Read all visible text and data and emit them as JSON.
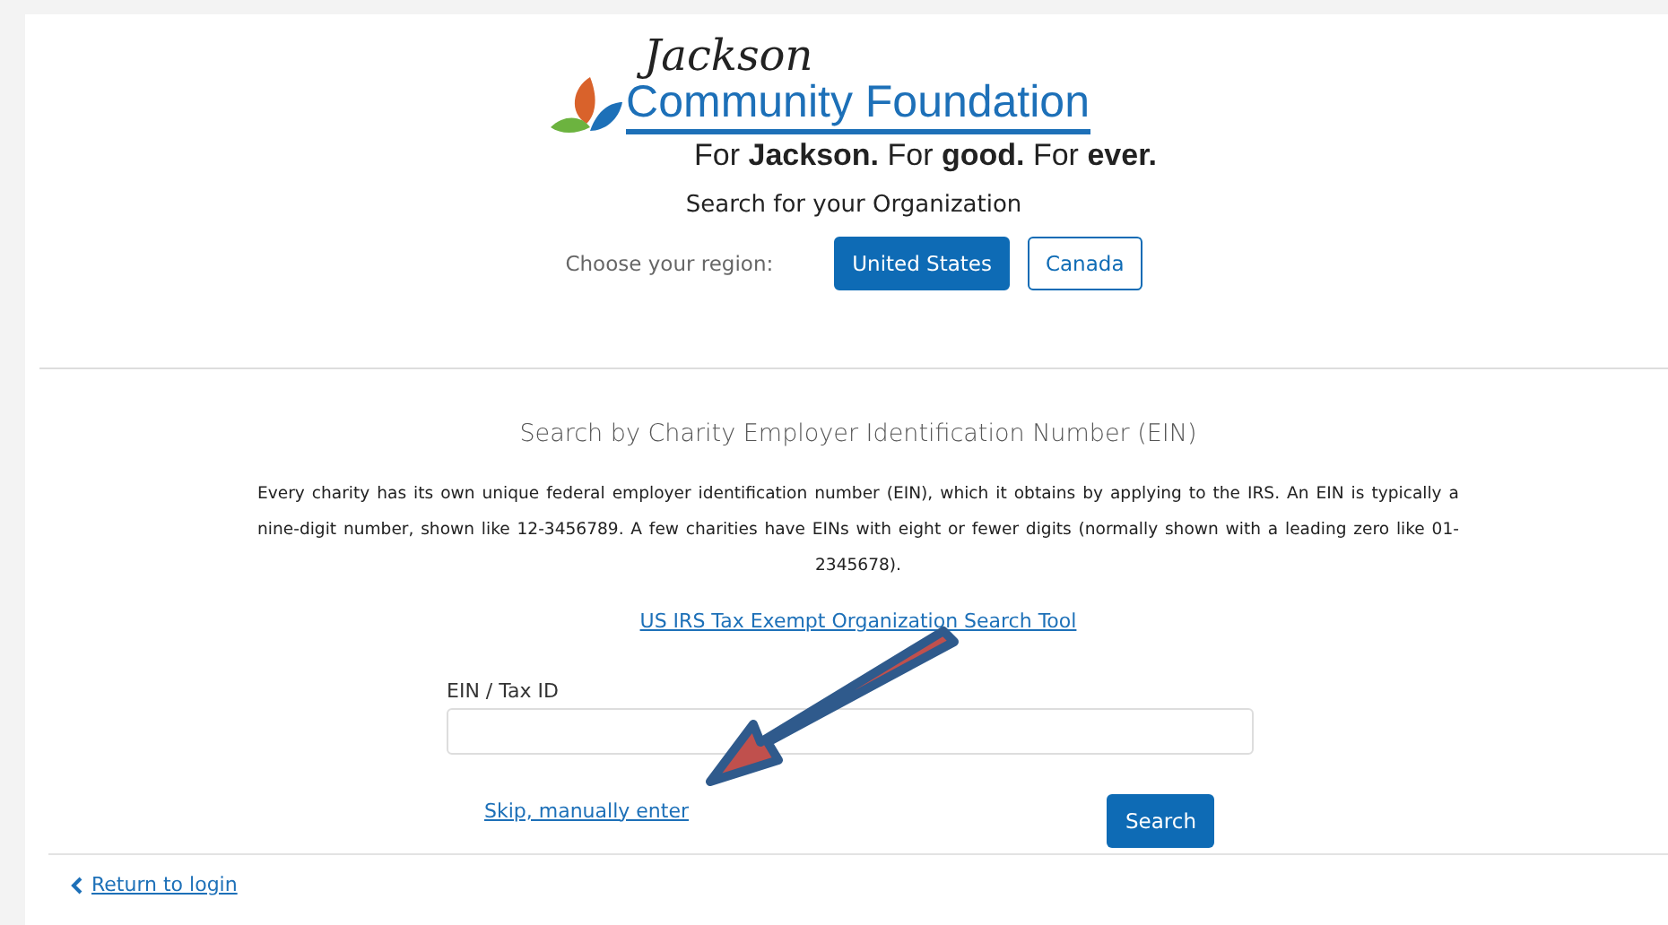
{
  "logo": {
    "script": "Jackson",
    "name": "Community Foundation",
    "tagline": "For **Jackson.** For **good.** For **ever.**"
  },
  "title": "Search for your Organization",
  "region": {
    "label": "Choose your region:",
    "options": [
      {
        "label": "United States",
        "selected": true
      },
      {
        "label": "Canada",
        "selected": false
      }
    ]
  },
  "ein_section": {
    "heading": "Search by Charity Employer Identification Number (EIN)",
    "description": "Every charity has its own unique federal employer identification number (EIN), which it obtains by applying to the IRS. An EIN is typically a nine-digit number, shown like 12-3456789. A few charities have EINs with eight or fewer digits (normally shown with a leading zero like 01-2345678).",
    "tool_link": "US IRS Tax Exempt Organization Search Tool",
    "field_label": "EIN / Tax ID",
    "skip_link": "Skip, manually enter",
    "search_button": "Search"
  },
  "footer": {
    "back_link": "Return to login"
  }
}
